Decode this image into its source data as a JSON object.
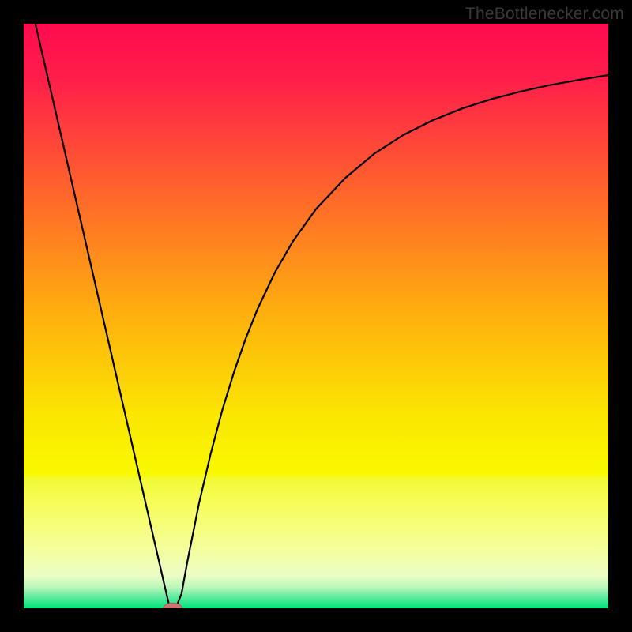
{
  "watermark": "TheBottlenecker.com",
  "chart_data": {
    "type": "line",
    "title": "",
    "xlabel": "",
    "ylabel": "",
    "xlim": [
      0,
      100
    ],
    "ylim": [
      0,
      100
    ],
    "background": {
      "kind": "vertical-gradient",
      "stops": [
        {
          "pos": 0.0,
          "color": "#ff0b4f"
        },
        {
          "pos": 0.09,
          "color": "#ff1d4b"
        },
        {
          "pos": 0.33,
          "color": "#ff7425"
        },
        {
          "pos": 0.5,
          "color": "#feb10e"
        },
        {
          "pos": 0.67,
          "color": "#fbe602"
        },
        {
          "pos": 0.77,
          "color": "#f9f900"
        },
        {
          "pos": 0.78,
          "color": "#f1f937"
        },
        {
          "pos": 0.82,
          "color": "#f7fd59"
        },
        {
          "pos": 0.9,
          "color": "#f4fe9e"
        },
        {
          "pos": 0.945,
          "color": "#eafdc6"
        },
        {
          "pos": 0.965,
          "color": "#b6f6b9"
        },
        {
          "pos": 0.98,
          "color": "#63eba0"
        },
        {
          "pos": 1.0,
          "color": "#00e47c"
        }
      ]
    },
    "series": [
      {
        "name": "bottleneck-curve",
        "color": "#000000",
        "width": 2.2,
        "x": [
          2.0,
          4,
          6,
          8,
          10,
          12,
          14,
          16,
          18,
          20,
          22,
          24,
          25,
          26,
          27,
          28,
          30,
          32,
          34,
          36,
          38,
          40,
          43,
          46,
          50,
          55,
          60,
          65,
          70,
          75,
          80,
          85,
          90,
          95,
          100
        ],
        "y": [
          100,
          91.3,
          82.6,
          73.9,
          65.2,
          56.5,
          47.8,
          39.1,
          30.4,
          21.7,
          13.0,
          4.3,
          0.0,
          0.0,
          2.5,
          8.0,
          18.0,
          26.5,
          34.0,
          40.5,
          46.2,
          51.2,
          57.5,
          62.7,
          68.3,
          73.6,
          77.8,
          81.0,
          83.5,
          85.5,
          87.1,
          88.4,
          89.5,
          90.4,
          91.2
        ]
      }
    ],
    "marker": {
      "name": "optimum-point",
      "cx": 25.5,
      "cy": 0.0,
      "rx": 1.6,
      "ry": 0.9,
      "fill": "#cb7471",
      "stroke": "#b35a57"
    }
  }
}
